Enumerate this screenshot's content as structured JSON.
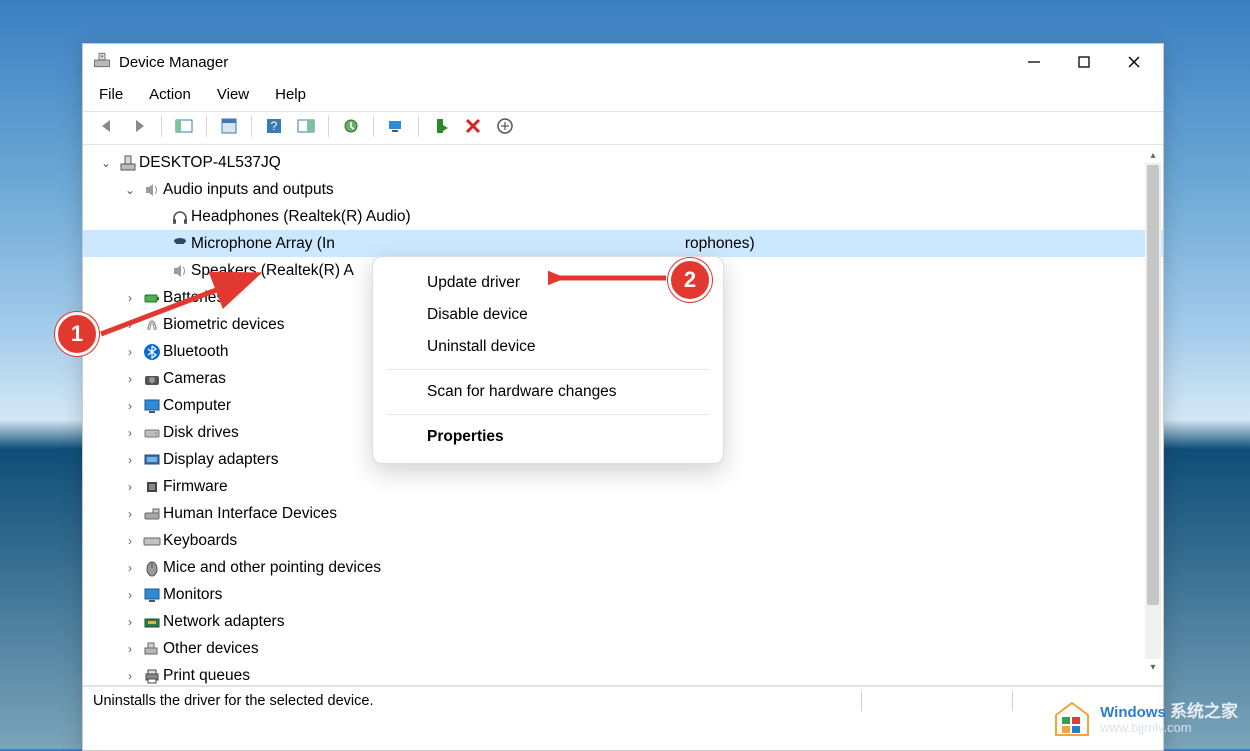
{
  "window": {
    "title": "Device Manager"
  },
  "menubar": [
    "File",
    "Action",
    "View",
    "Help"
  ],
  "tree": {
    "root": "DESKTOP-4L537JQ",
    "audio_category": "Audio inputs and outputs",
    "audio_children": {
      "headphones": "Headphones (Realtek(R) Audio)",
      "microphone": "Microphone Array (Intel Smart Sound Technology (Microphones)",
      "microphone_visible_tail": "rophones)",
      "speakers": "Speakers (Realtek(R) A"
    },
    "categories": [
      "Batteries",
      "Biometric devices",
      "Bluetooth",
      "Cameras",
      "Computer",
      "Disk drives",
      "Display adapters",
      "Firmware",
      "Human Interface Devices",
      "Keyboards",
      "Mice and other pointing devices",
      "Monitors",
      "Network adapters",
      "Other devices",
      "Print queues"
    ]
  },
  "contextmenu": {
    "update_driver": "Update driver",
    "disable_device": "Disable device",
    "uninstall_device": "Uninstall device",
    "scan": "Scan for hardware changes",
    "properties": "Properties"
  },
  "statusbar": "Uninstalls the driver for the selected device.",
  "annotations": {
    "one": "1",
    "two": "2"
  },
  "watermark": {
    "brand_en": "Windows",
    "brand_cn": "系统之家",
    "url": "www.bjjmlv.com"
  }
}
